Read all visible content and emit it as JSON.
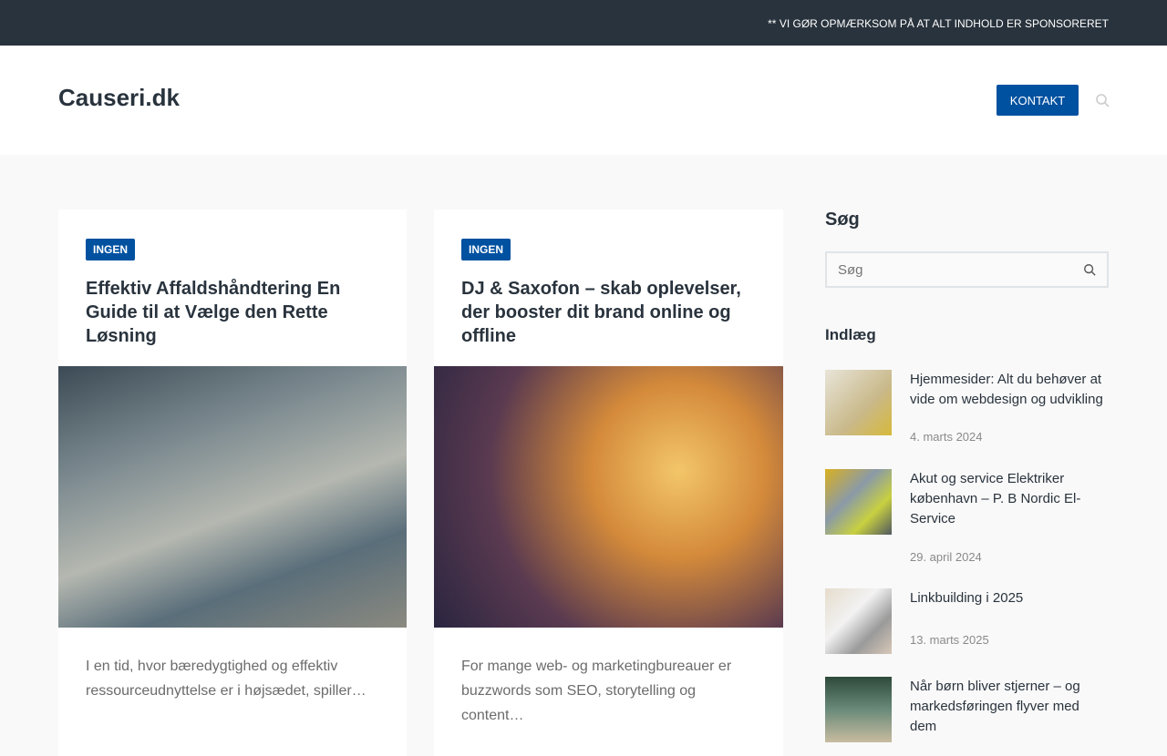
{
  "topbar": {
    "notice": "** VI GØR OPMÆRKSOM PÅ AT ALT INDHOLD ER SPONSORERET"
  },
  "header": {
    "logo": "Causeri.dk",
    "kontakt": "KONTAKT"
  },
  "cards": [
    {
      "category": "INGEN",
      "title": "Effektiv Affaldshåndtering En Guide til at Vælge den Rette Løsning",
      "excerpt": "I en tid, hvor bæredygtighed og effektiv ressourceudnyttelse er i højsædet, spiller…"
    },
    {
      "category": "INGEN",
      "title": "DJ & Saxofon – skab oplevelser, der booster dit brand online og offline",
      "excerpt": "For mange web- og marketingbureauer er buzzwords som SEO, storytelling og content…"
    }
  ],
  "sidebar": {
    "search_heading": "Søg",
    "search_placeholder": "Søg",
    "posts_heading": "Indlæg",
    "posts": [
      {
        "title": "Hjemmesider: Alt du behøver at vide om webdesign og udvikling",
        "date": "4. marts 2024"
      },
      {
        "title": "Akut og service Elektriker københavn – P. B Nordic El-Service",
        "date": "29. april 2024"
      },
      {
        "title": "Linkbuilding i 2025",
        "date": "13. marts 2025"
      },
      {
        "title": "Når børn bliver stjerner – og markedsføringen flyver med dem",
        "date": ""
      }
    ]
  }
}
